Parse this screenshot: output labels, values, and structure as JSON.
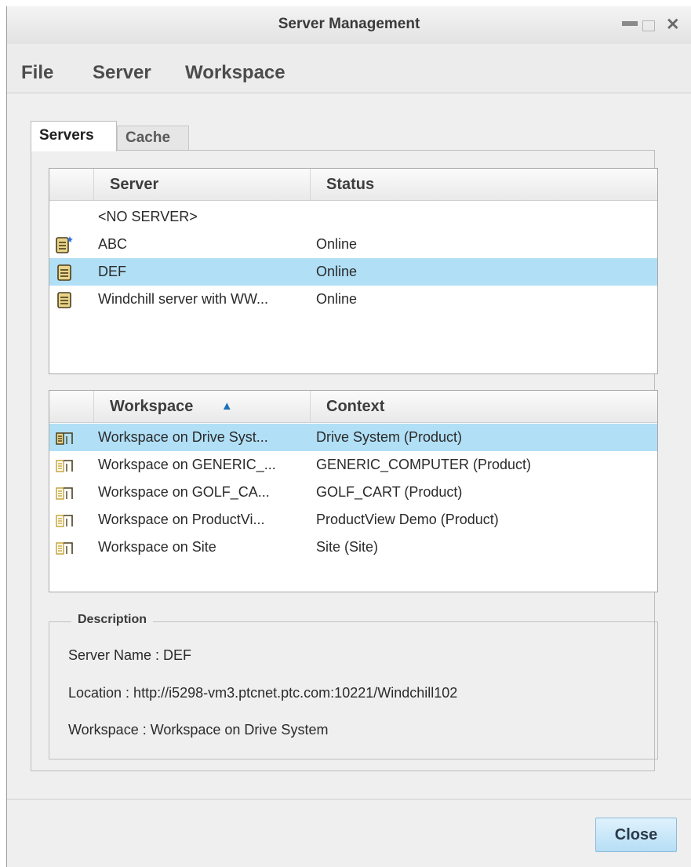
{
  "window": {
    "title": "Server Management"
  },
  "menu": [
    "File",
    "Server",
    "Workspace"
  ],
  "tabs": [
    "Servers",
    "Cache"
  ],
  "server_table": {
    "columns": [
      "Server",
      "Status"
    ],
    "rows": [
      {
        "server": "<NO SERVER>",
        "status": "",
        "icon": "none"
      },
      {
        "server": "ABC",
        "status": "Online",
        "icon": "active-server-icon"
      },
      {
        "server": "DEF",
        "status": "Online",
        "icon": "server-icon",
        "selected": true
      },
      {
        "server": "Windchill server with WW...",
        "status": "Online",
        "icon": "server-icon"
      }
    ]
  },
  "workspace_table": {
    "columns": [
      "Workspace",
      "Context"
    ],
    "sort_indicator": "▲",
    "rows": [
      {
        "workspace": "Workspace on Drive Syst...",
        "context": "Drive System (Product)",
        "icon": "workspace-active-icon",
        "selected": true
      },
      {
        "workspace": "Workspace on GENERIC_...",
        "context": "GENERIC_COMPUTER (Product)",
        "icon": "workspace-icon"
      },
      {
        "workspace": "Workspace on GOLF_CA...",
        "context": "GOLF_CART (Product)",
        "icon": "workspace-icon"
      },
      {
        "workspace": "Workspace on ProductVi...",
        "context": "ProductView Demo (Product)",
        "icon": "workspace-icon"
      },
      {
        "workspace": "Workspace on Site",
        "context": "Site (Site)",
        "icon": "workspace-icon"
      }
    ]
  },
  "description": {
    "legend": "Description",
    "server_name": "Server Name : DEF",
    "location": "Location : http://i5298-vm3.ptcnet.ptc.com:10221/Windchill102",
    "workspace": "Workspace : Workspace on Drive System"
  },
  "buttons": {
    "close": "Close"
  },
  "colors": {
    "selection": "#b1dff6",
    "accent_arrow": "#1e6fb8"
  }
}
